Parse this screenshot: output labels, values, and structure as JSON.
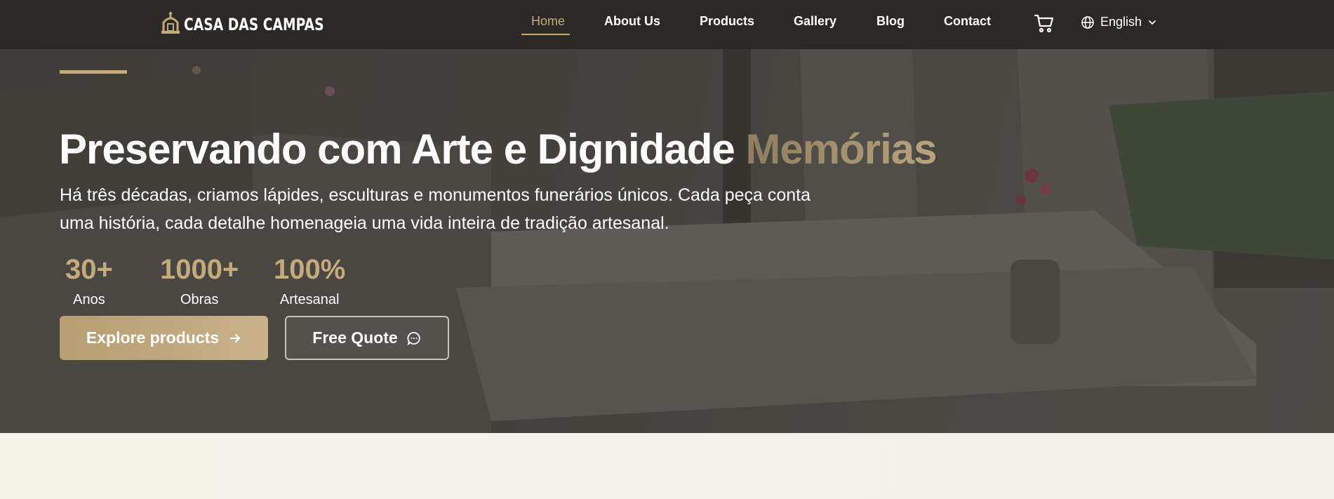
{
  "brand": {
    "name": "CASA DAS CAMPAS"
  },
  "nav": {
    "items": [
      {
        "label": "Home",
        "active": true
      },
      {
        "label": "About Us",
        "active": false
      },
      {
        "label": "Products",
        "active": false
      },
      {
        "label": "Gallery",
        "active": false
      },
      {
        "label": "Blog",
        "active": false
      },
      {
        "label": "Contact",
        "active": false
      }
    ],
    "cart_icon": "cart-icon",
    "language": {
      "label": "English",
      "icon": "globe-icon"
    }
  },
  "hero": {
    "title_main": "Preservando com Arte e Dignidade ",
    "title_highlight": "Memórias",
    "description": "Há três décadas, criamos lápides, esculturas e monumentos funerários únicos. Cada peça conta uma história, cada detalhe homenageia uma vida inteira de tradição artesanal.",
    "stats": [
      {
        "value": "30+",
        "label": "Anos"
      },
      {
        "value": "1000+",
        "label": "Obras"
      },
      {
        "value": "100%",
        "label": "Artesanal"
      }
    ],
    "primary_button": "Explore products",
    "secondary_button": "Free Quote"
  },
  "colors": {
    "accent": "#c4ab7c",
    "navbar": "#2a2927",
    "section_bg": "#f3f1ea"
  }
}
